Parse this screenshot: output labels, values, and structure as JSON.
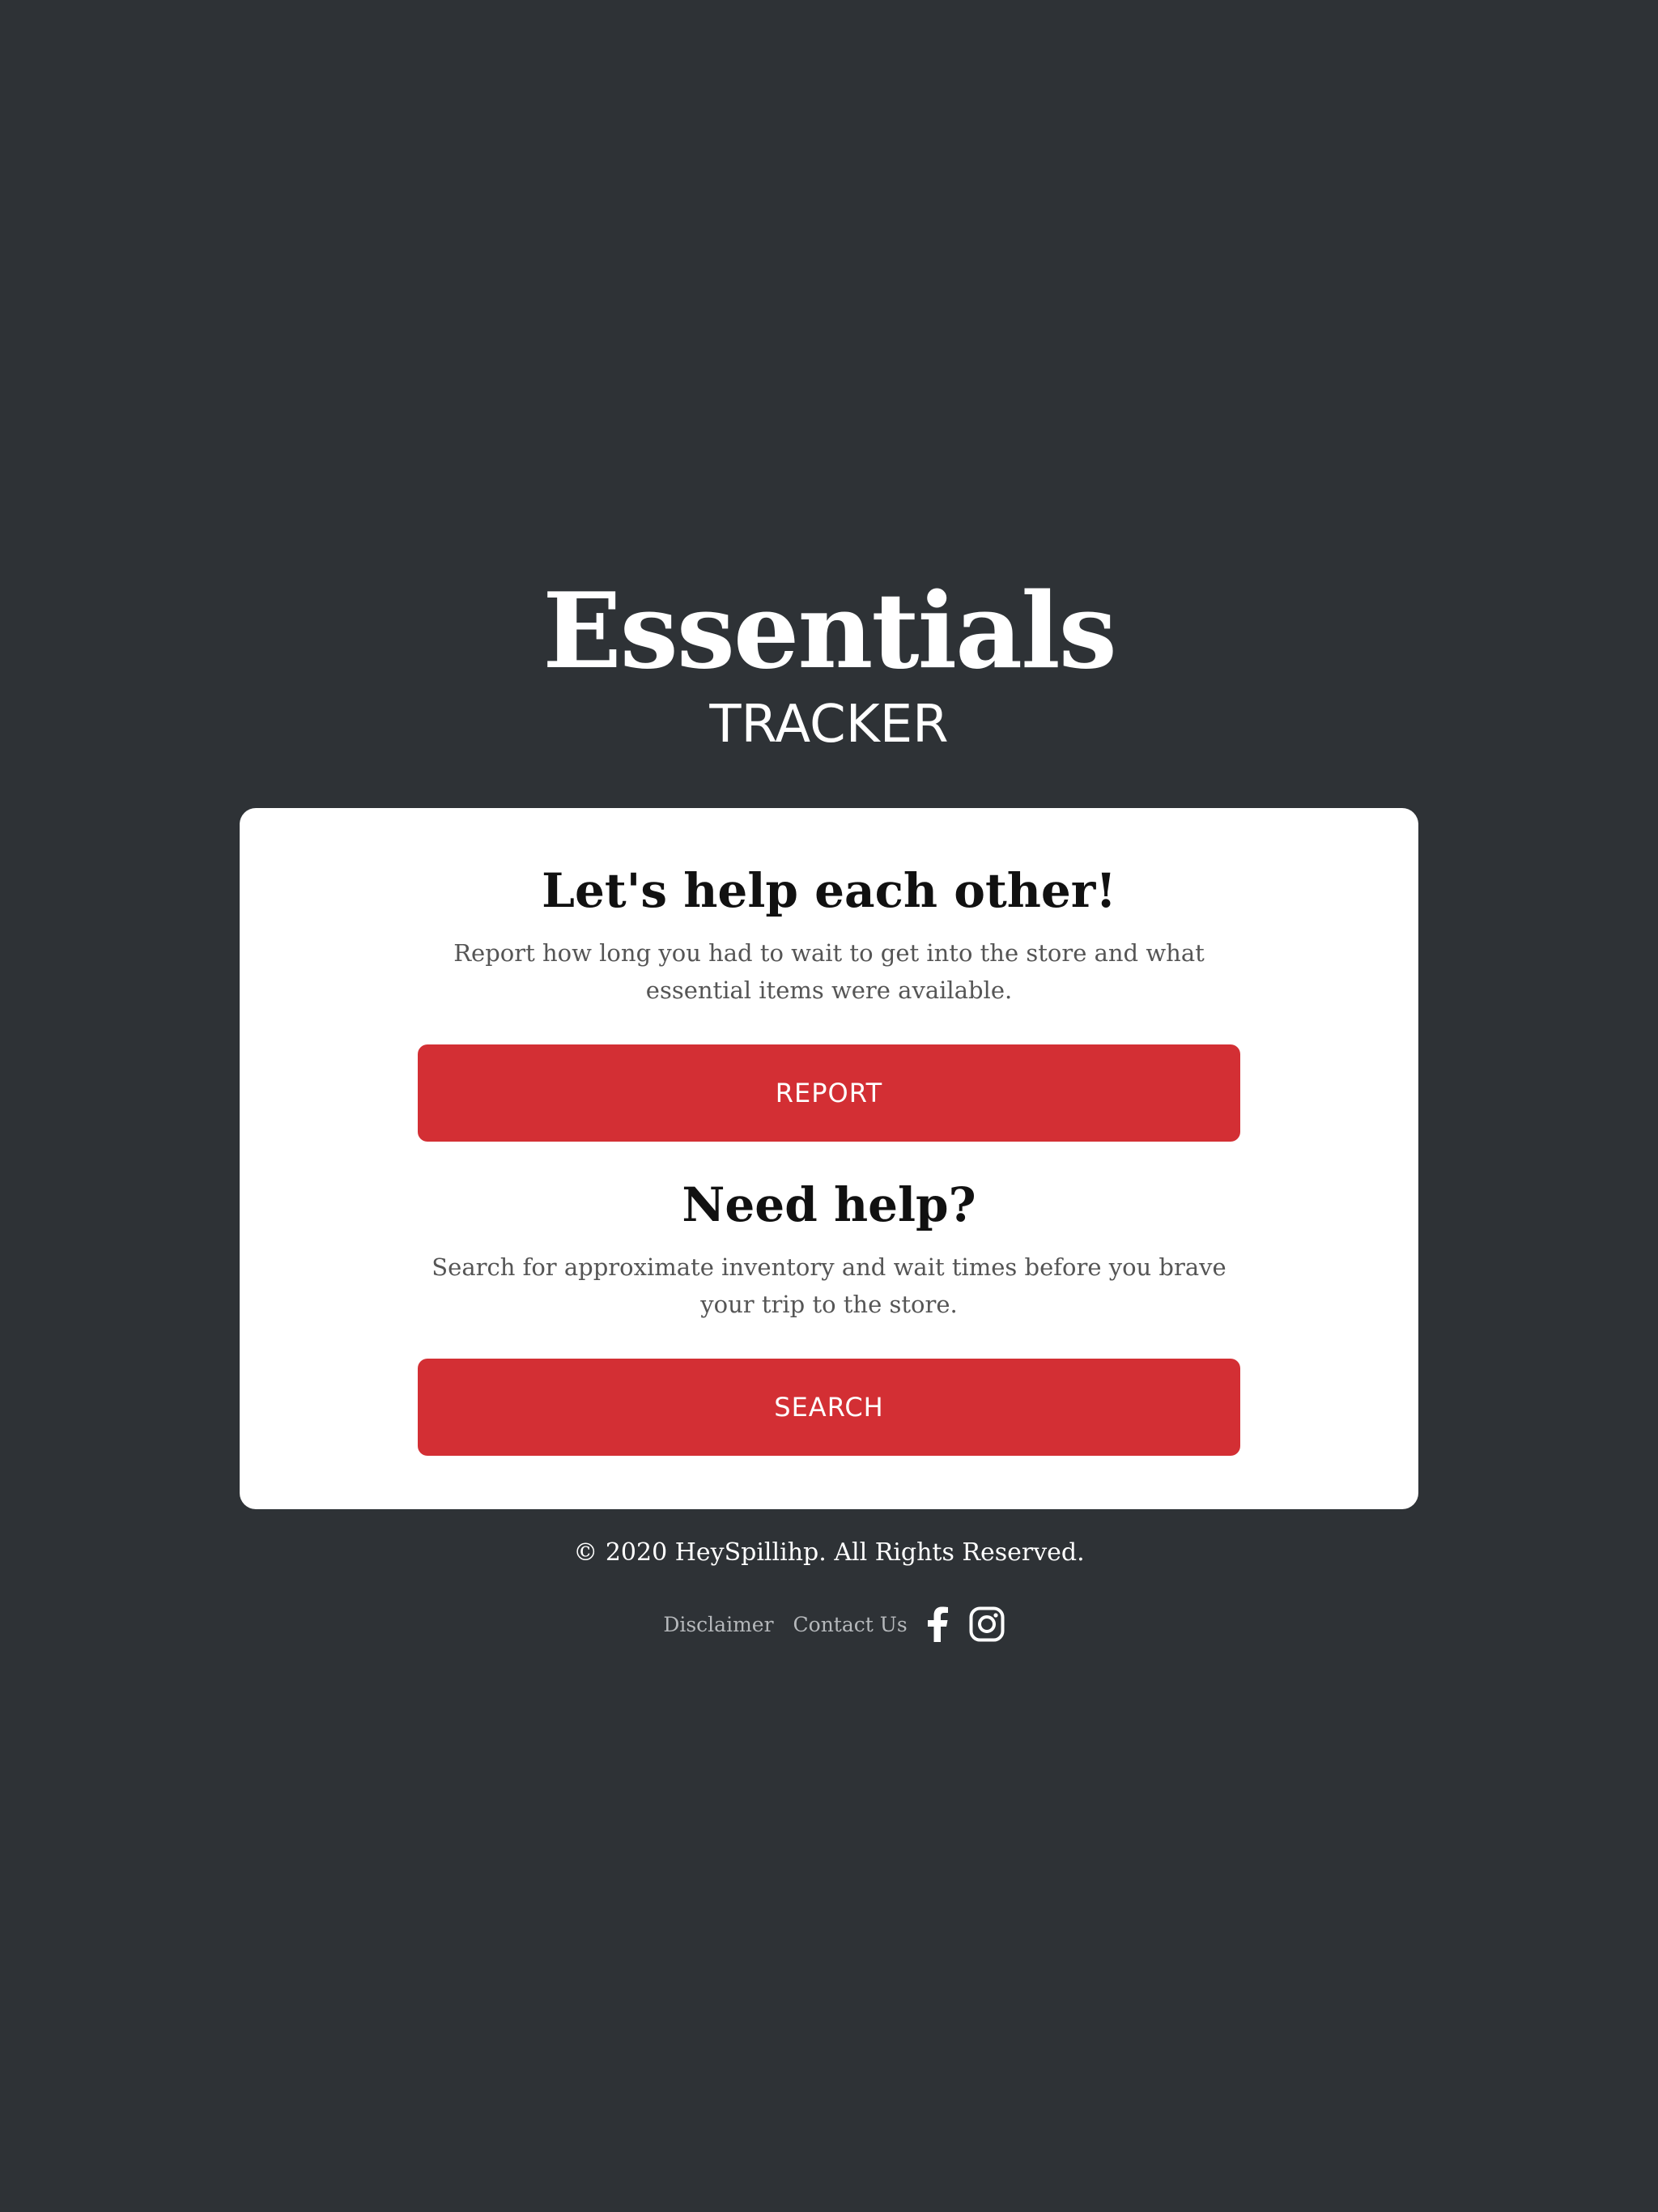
{
  "header": {
    "title": "Essentials",
    "subtitle": "TRACKER"
  },
  "card": {
    "report_section": {
      "heading": "Let's help each other!",
      "description": "Report how long you had to wait to get into the store and what essential items were available.",
      "button_label": "REPORT"
    },
    "search_section": {
      "heading": "Need help?",
      "description": "Search for approximate inventory and wait times before you brave your trip to the store.",
      "button_label": "SEARCH"
    }
  },
  "footer": {
    "copyright": "© 2020 HeySpillihp. All Rights Reserved.",
    "links": {
      "disclaimer": "Disclaimer",
      "contact": "Contact Us"
    },
    "social": {
      "facebook_icon": "facebook-icon",
      "instagram_icon": "instagram-icon"
    }
  },
  "colors": {
    "background": "#2e3236",
    "card": "#ffffff",
    "accent": "#d32f34",
    "link": "#b5b8bb"
  }
}
